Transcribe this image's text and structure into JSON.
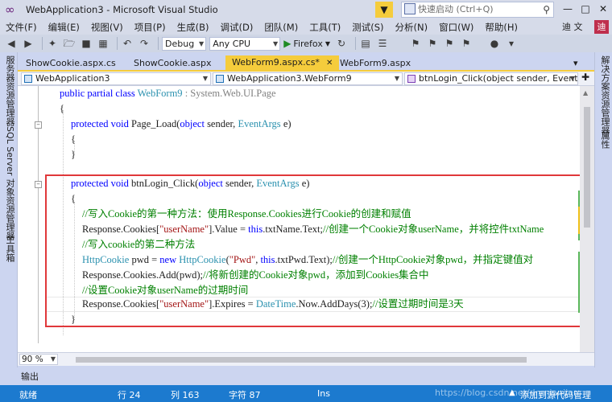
{
  "window": {
    "title": "WebApplication3 - Microsoft Visual Studio",
    "quick_launch_placeholder": "快速启动 (Ctrl+Q)",
    "user_name": "迪 文",
    "user_avatar": "迪"
  },
  "menu": [
    "文件(F)",
    "编辑(E)",
    "视图(V)",
    "项目(P)",
    "生成(B)",
    "调试(D)",
    "团队(M)",
    "工具(T)",
    "测试(S)",
    "分析(N)",
    "窗口(W)",
    "帮助(H)"
  ],
  "toolbar": {
    "config": "Debug",
    "platform": "Any CPU",
    "run_target": "Firefox"
  },
  "left_strip": [
    "服务器资源管理器",
    "SQL Server 对象资源管理器",
    "工具箱"
  ],
  "right_strip": [
    "解决方案资源管理器",
    "属性"
  ],
  "tabs": [
    {
      "label": "ShowCookie.aspx.cs",
      "active": false
    },
    {
      "label": "ShowCookie.aspx",
      "active": false
    },
    {
      "label": "WebForm9.aspx.cs*",
      "active": true
    },
    {
      "label": "WebForm9.aspx",
      "active": false
    }
  ],
  "nav": {
    "project": "WebApplication3",
    "class": "WebApplication3.WebForm9",
    "member": "btnLogin_Click(object sender, EventArgs e)"
  },
  "code": {
    "l1": {
      "kw": "public partial class ",
      "ty": "WebForm9",
      "rest": " : System.Web.UI.Page"
    },
    "l2": "{",
    "l3": {
      "kw": "protected void ",
      "name": "Page_Load(",
      "kw2": "object",
      "mid": " sender, ",
      "ty": "EventArgs",
      "end": " e)"
    },
    "l4": "{",
    "l5": "}",
    "l6": {
      "kw": "protected void ",
      "name": "btnLogin_Click(",
      "kw2": "object",
      "mid": " sender, ",
      "ty": "EventArgs",
      "end": " e)"
    },
    "l7": "{",
    "l8": "//写入Cookie的第一种方法：使用Response.Cookies进行Cookie的创建和赋值",
    "l9": {
      "a": "Response.Cookies[",
      "str": "\"userName\"",
      "b": "].Value = ",
      "kw": "this",
      "c": ".txtName.Text;",
      "cm": "//创建一个Cookie对象userName，并将控件txtName"
    },
    "l10": "//写入cookie的第二种方法",
    "l11": {
      "ty": "HttpCookie",
      "a": " pwd = ",
      "kw": "new ",
      "ty2": "HttpCookie",
      "b": "(",
      "str": "\"Pwd\"",
      "c": ", ",
      "kw2": "this",
      "d": ".txtPwd.Text);",
      "cm": "//创建一个HttpCookie对象pwd，并指定键值对"
    },
    "l12": {
      "a": "Response.Cookies.Add(pwd);",
      "cm": "//将新创建的Cookie对象pwd，添加到Cookies集合中"
    },
    "l13": "//设置Cookie对象userName的过期时间",
    "l14": {
      "a": "Response.Cookies[",
      "str": "\"userName\"",
      "b": "].Expires = ",
      "ty": "DateTime",
      "c": ".Now.AddDays(3);",
      "cm": "//设置过期时间是3天"
    },
    "l15": "}"
  },
  "zoom": "90 %",
  "output_tab": "输出",
  "status": {
    "ready": "就绪",
    "line": "行 24",
    "col": "列 163",
    "char": "字符 87",
    "ins": "Ins",
    "source_control": "添加到源代码管理",
    "watermark": "https://blog.csdn.net/dnmianjian"
  },
  "colors": {
    "accent": "#f5cc3c",
    "status_bar": "#1c7acf",
    "highlight_box": "#e0383a"
  }
}
